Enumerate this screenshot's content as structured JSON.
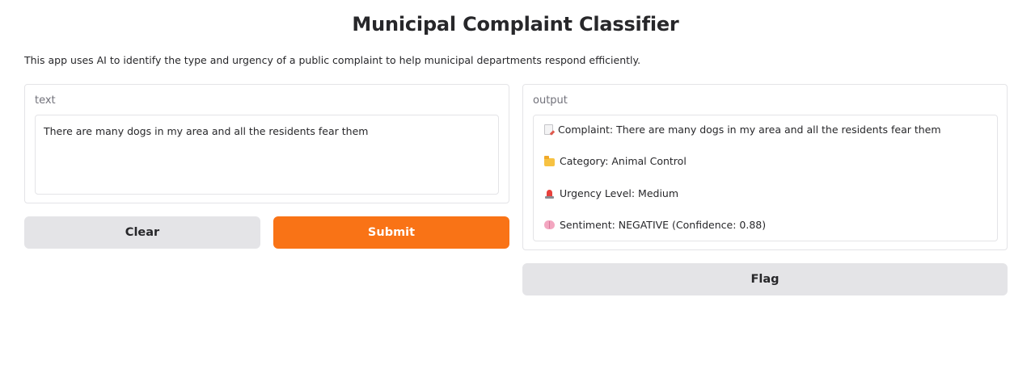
{
  "app": {
    "title": "Municipal Complaint Classifier",
    "description": "This app uses AI to identify the type and urgency of a public complaint to help municipal departments respond efficiently."
  },
  "input_panel": {
    "label": "text",
    "value": "There are many dogs in my area and all the residents fear them"
  },
  "output_panel": {
    "label": "output",
    "lines": [
      {
        "icon": "memo-icon",
        "text": "Complaint: There are many dogs in my area and all the residents fear them"
      },
      {
        "icon": "folder-icon",
        "text": "Category: Animal Control"
      },
      {
        "icon": "siren-icon",
        "text": "Urgency Level: Medium"
      },
      {
        "icon": "brain-icon",
        "text": "Sentiment: NEGATIVE (Confidence: 0.88)"
      }
    ]
  },
  "buttons": {
    "clear_label": "Clear",
    "submit_label": "Submit",
    "flag_label": "Flag"
  },
  "colors": {
    "accent": "#f97316",
    "secondary_button": "#e4e4e7",
    "border": "#e4e4e7",
    "label_text": "#71717a"
  }
}
